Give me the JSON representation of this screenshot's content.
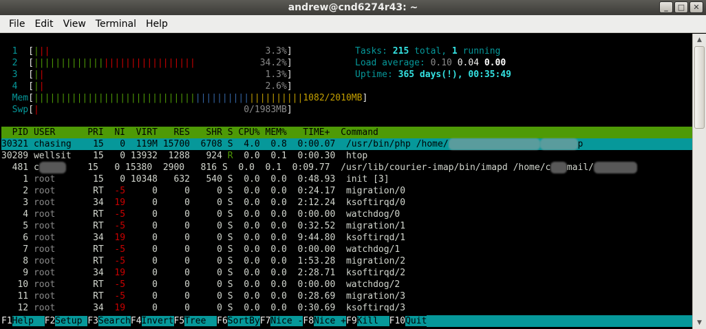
{
  "window": {
    "title": "andrew@cnd6274r43: ~",
    "buttons": [
      "_",
      "□",
      "✕"
    ]
  },
  "menubar": [
    "File",
    "Edit",
    "View",
    "Terminal",
    "Help"
  ],
  "meters": {
    "cpus": [
      {
        "label": "1",
        "bars": "|||",
        "percent": "3.3%"
      },
      {
        "label": "2",
        "bars": "||||||||||||||||||||||||||||||",
        "percent": "34.2%"
      },
      {
        "label": "3",
        "bars": "||",
        "percent": "1.3%"
      },
      {
        "label": "4",
        "bars": "||",
        "percent": "2.6%"
      }
    ],
    "mem": {
      "label": "Mem",
      "bars": "||||||||||||||||||||||||||||||||||||||||||||||||||",
      "value": "1082/2010MB"
    },
    "swp": {
      "label": "Swp",
      "bars": "|",
      "value": "0/1983MB"
    }
  },
  "summary": {
    "tasks_label": "Tasks: ",
    "tasks_total": "215",
    "tasks_mid": " total, ",
    "tasks_running": "1",
    "tasks_end": " running",
    "load_label": "Load average: ",
    "load1": "0.10",
    "load5": "0.04",
    "load15": "0.00",
    "uptime_label": "Uptime: ",
    "uptime_value": "365 days(!), 00:35:49"
  },
  "table": {
    "header": "  PID USER      PRI  NI  VIRT   RES   SHR S CPU% MEM%   TIME+  Command",
    "rows": [
      {
        "pid": "30321",
        "user": "chasing",
        "pri": "15",
        "ni": "0",
        "virt": "119M",
        "res": "15700",
        "shr": "6708",
        "s": "S",
        "cpu": "4.0",
        "mem": "0.8",
        "time": "0:00.07",
        "cmd": "/usr/bin/php /home/",
        "selected": true
      },
      {
        "pid": "30289",
        "user": "wellsit",
        "pri": "15",
        "ni": "0",
        "virt": "13932",
        "res": "1288",
        "shr": "924",
        "s": "R",
        "cpu": "0.0",
        "mem": "0.1",
        "time": "0:00.30",
        "cmd": "htop"
      },
      {
        "pid": "481",
        "user": "c",
        "pri": "15",
        "ni": "0",
        "virt": "15380",
        "res": "2900",
        "shr": "816",
        "s": "S",
        "cpu": "0.0",
        "mem": "0.1",
        "time": "0:09.77",
        "cmd": "/usr/lib/courier-imap/bin/imapd /home/c",
        "cmd2": "mail/"
      },
      {
        "pid": "1",
        "user": "root",
        "pri": "15",
        "ni": "0",
        "virt": "10348",
        "res": "632",
        "shr": "540",
        "s": "S",
        "cpu": "0.0",
        "mem": "0.0",
        "time": "0:48.93",
        "cmd": "init [3]"
      },
      {
        "pid": "2",
        "user": "root",
        "pri": "RT",
        "ni": "-5",
        "virt": "0",
        "res": "0",
        "shr": "0",
        "s": "S",
        "cpu": "0.0",
        "mem": "0.0",
        "time": "0:24.17",
        "cmd": "migration/0"
      },
      {
        "pid": "3",
        "user": "root",
        "pri": "34",
        "ni": "19",
        "virt": "0",
        "res": "0",
        "shr": "0",
        "s": "S",
        "cpu": "0.0",
        "mem": "0.0",
        "time": "2:12.24",
        "cmd": "ksoftirqd/0"
      },
      {
        "pid": "4",
        "user": "root",
        "pri": "RT",
        "ni": "-5",
        "virt": "0",
        "res": "0",
        "shr": "0",
        "s": "S",
        "cpu": "0.0",
        "mem": "0.0",
        "time": "0:00.00",
        "cmd": "watchdog/0"
      },
      {
        "pid": "5",
        "user": "root",
        "pri": "RT",
        "ni": "-5",
        "virt": "0",
        "res": "0",
        "shr": "0",
        "s": "S",
        "cpu": "0.0",
        "mem": "0.0",
        "time": "0:32.52",
        "cmd": "migration/1"
      },
      {
        "pid": "6",
        "user": "root",
        "pri": "34",
        "ni": "19",
        "virt": "0",
        "res": "0",
        "shr": "0",
        "s": "S",
        "cpu": "0.0",
        "mem": "0.0",
        "time": "9:44.80",
        "cmd": "ksoftirqd/1"
      },
      {
        "pid": "7",
        "user": "root",
        "pri": "RT",
        "ni": "-5",
        "virt": "0",
        "res": "0",
        "shr": "0",
        "s": "S",
        "cpu": "0.0",
        "mem": "0.0",
        "time": "0:00.00",
        "cmd": "watchdog/1"
      },
      {
        "pid": "8",
        "user": "root",
        "pri": "RT",
        "ni": "-5",
        "virt": "0",
        "res": "0",
        "shr": "0",
        "s": "S",
        "cpu": "0.0",
        "mem": "0.0",
        "time": "1:53.28",
        "cmd": "migration/2"
      },
      {
        "pid": "9",
        "user": "root",
        "pri": "34",
        "ni": "19",
        "virt": "0",
        "res": "0",
        "shr": "0",
        "s": "S",
        "cpu": "0.0",
        "mem": "0.0",
        "time": "2:28.71",
        "cmd": "ksoftirqd/2"
      },
      {
        "pid": "10",
        "user": "root",
        "pri": "RT",
        "ni": "-5",
        "virt": "0",
        "res": "0",
        "shr": "0",
        "s": "S",
        "cpu": "0.0",
        "mem": "0.0",
        "time": "0:00.00",
        "cmd": "watchdog/2"
      },
      {
        "pid": "11",
        "user": "root",
        "pri": "RT",
        "ni": "-5",
        "virt": "0",
        "res": "0",
        "shr": "0",
        "s": "S",
        "cpu": "0.0",
        "mem": "0.0",
        "time": "0:28.69",
        "cmd": "migration/3"
      },
      {
        "pid": "12",
        "user": "root",
        "pri": "34",
        "ni": "19",
        "virt": "0",
        "res": "0",
        "shr": "0",
        "s": "S",
        "cpu": "0.0",
        "mem": "0.0",
        "time": "0:30.69",
        "cmd": "ksoftirqd/3"
      }
    ]
  },
  "footer": [
    {
      "key": "F1",
      "label": "Help  "
    },
    {
      "key": "F2",
      "label": "Setup "
    },
    {
      "key": "F3",
      "label": "Search"
    },
    {
      "key": "F4",
      "label": "Invert"
    },
    {
      "key": "F5",
      "label": "Tree  "
    },
    {
      "key": "F6",
      "label": "SortBy"
    },
    {
      "key": "F7",
      "label": "Nice -"
    },
    {
      "key": "F8",
      "label": "Nice +"
    },
    {
      "key": "F9",
      "label": "Kill  "
    },
    {
      "key": "F10",
      "label": "Quit"
    }
  ],
  "colors": {
    "header_bg": "#4e9a06",
    "selected_bg": "#06989a",
    "meter_cyan": "#06989a",
    "nice_red": "#cc0000"
  }
}
